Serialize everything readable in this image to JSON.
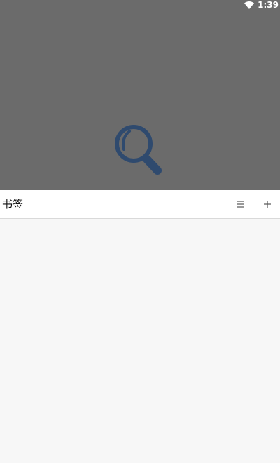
{
  "status_bar": {
    "time": "1:39",
    "wifi_icon": "wifi-icon"
  },
  "header_image": {
    "icon": "magnifier-icon",
    "background_color": "#6b6b6b",
    "icon_color": "#2f4a6e"
  },
  "toolbar": {
    "title": "书签",
    "list_icon": "list-icon",
    "add_icon": "plus-icon"
  },
  "content": {
    "items": []
  }
}
